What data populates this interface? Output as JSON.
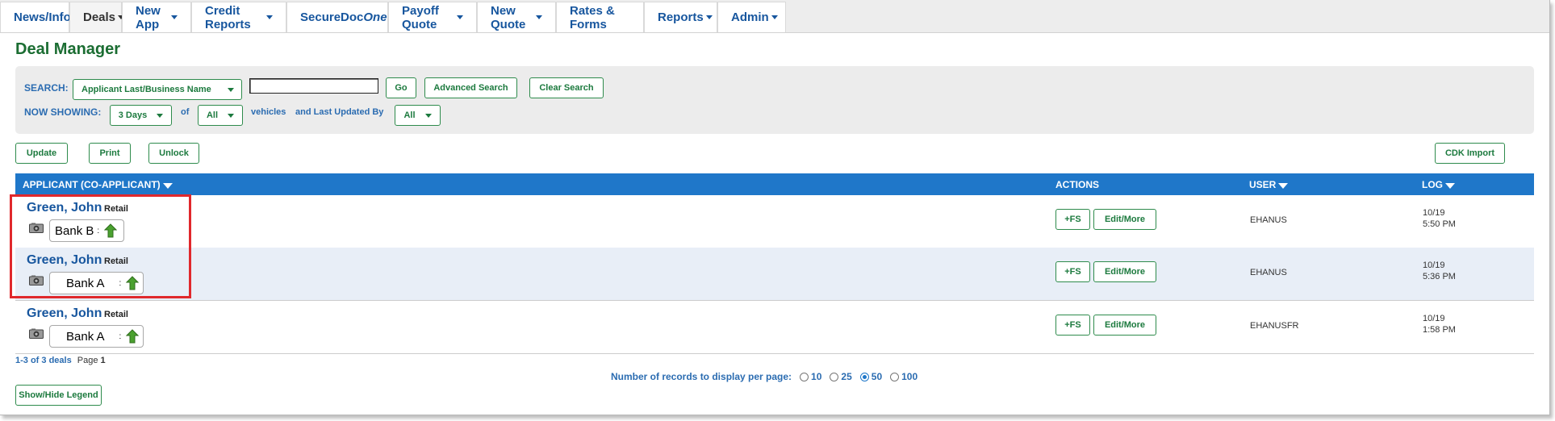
{
  "tabs": [
    {
      "label": "News/Info",
      "dropdown": false,
      "active": false
    },
    {
      "label": "Deals",
      "dropdown": true,
      "active": true
    },
    {
      "label": "New App",
      "dropdown": true,
      "active": false
    },
    {
      "label": "Credit Reports",
      "dropdown": true,
      "active": false
    },
    {
      "label": "SecureDoc",
      "label_italic": "One",
      "dropdown": true,
      "active": false
    },
    {
      "label": "Payoff Quote",
      "dropdown": true,
      "active": false
    },
    {
      "label": "New Quote",
      "dropdown": true,
      "active": false
    },
    {
      "label": "Rates & Forms",
      "dropdown": false,
      "active": false
    },
    {
      "label": "Reports",
      "dropdown": true,
      "active": false
    },
    {
      "label": "Admin",
      "dropdown": true,
      "active": false
    }
  ],
  "page_title": "Deal Manager",
  "search": {
    "label": "SEARCH:",
    "field_select": "Applicant Last/Business Name",
    "input_value": "",
    "go": "Go",
    "advanced": "Advanced Search",
    "clear": "Clear Search"
  },
  "showing": {
    "label": "NOW SHOWING:",
    "period": "3 Days",
    "of": "of",
    "vehicles_select": "All",
    "vehicles_text": "vehicles",
    "updated_text": "and Last Updated By",
    "updated_select": "All"
  },
  "toolbar": {
    "update": "Update",
    "print": "Print",
    "unlock": "Unlock",
    "cdk_import": "CDK Import"
  },
  "table": {
    "col_applicant": "APPLICANT (CO-APPLICANT)",
    "col_actions": "ACTIONS",
    "col_user": "USER",
    "col_log": "LOG",
    "rows": [
      {
        "name": "Green, John",
        "type": "Retail",
        "bank": "Bank B",
        "fs": "+FS",
        "edit": "Edit/More",
        "user": "EHANUS",
        "date": "10/19",
        "time": "5:50 PM"
      },
      {
        "name": "Green, John",
        "type": "Retail",
        "bank": "Bank A",
        "fs": "+FS",
        "edit": "Edit/More",
        "user": "EHANUS",
        "date": "10/19",
        "time": "5:36 PM"
      },
      {
        "name": "Green, John",
        "type": "Retail",
        "bank": "Bank A",
        "fs": "+FS",
        "edit": "Edit/More",
        "user": "EHANUSFR",
        "date": "10/19",
        "time": "1:58 PM"
      }
    ]
  },
  "footer": {
    "count": "1-3 of 3 deals",
    "page_label": "Page",
    "page_num": "1",
    "rpp_label": "Number of records to display per page:",
    "rpp_options": [
      "10",
      "25",
      "50",
      "100"
    ],
    "rpp_selected": "50",
    "legend_button": "Show/Hide Legend"
  },
  "colors": {
    "tab_text": "#17569e",
    "title_green": "#1b6d32",
    "button_green": "#1c7a3e",
    "header_blue": "#1f77c9",
    "highlight_red": "#e0282c"
  }
}
